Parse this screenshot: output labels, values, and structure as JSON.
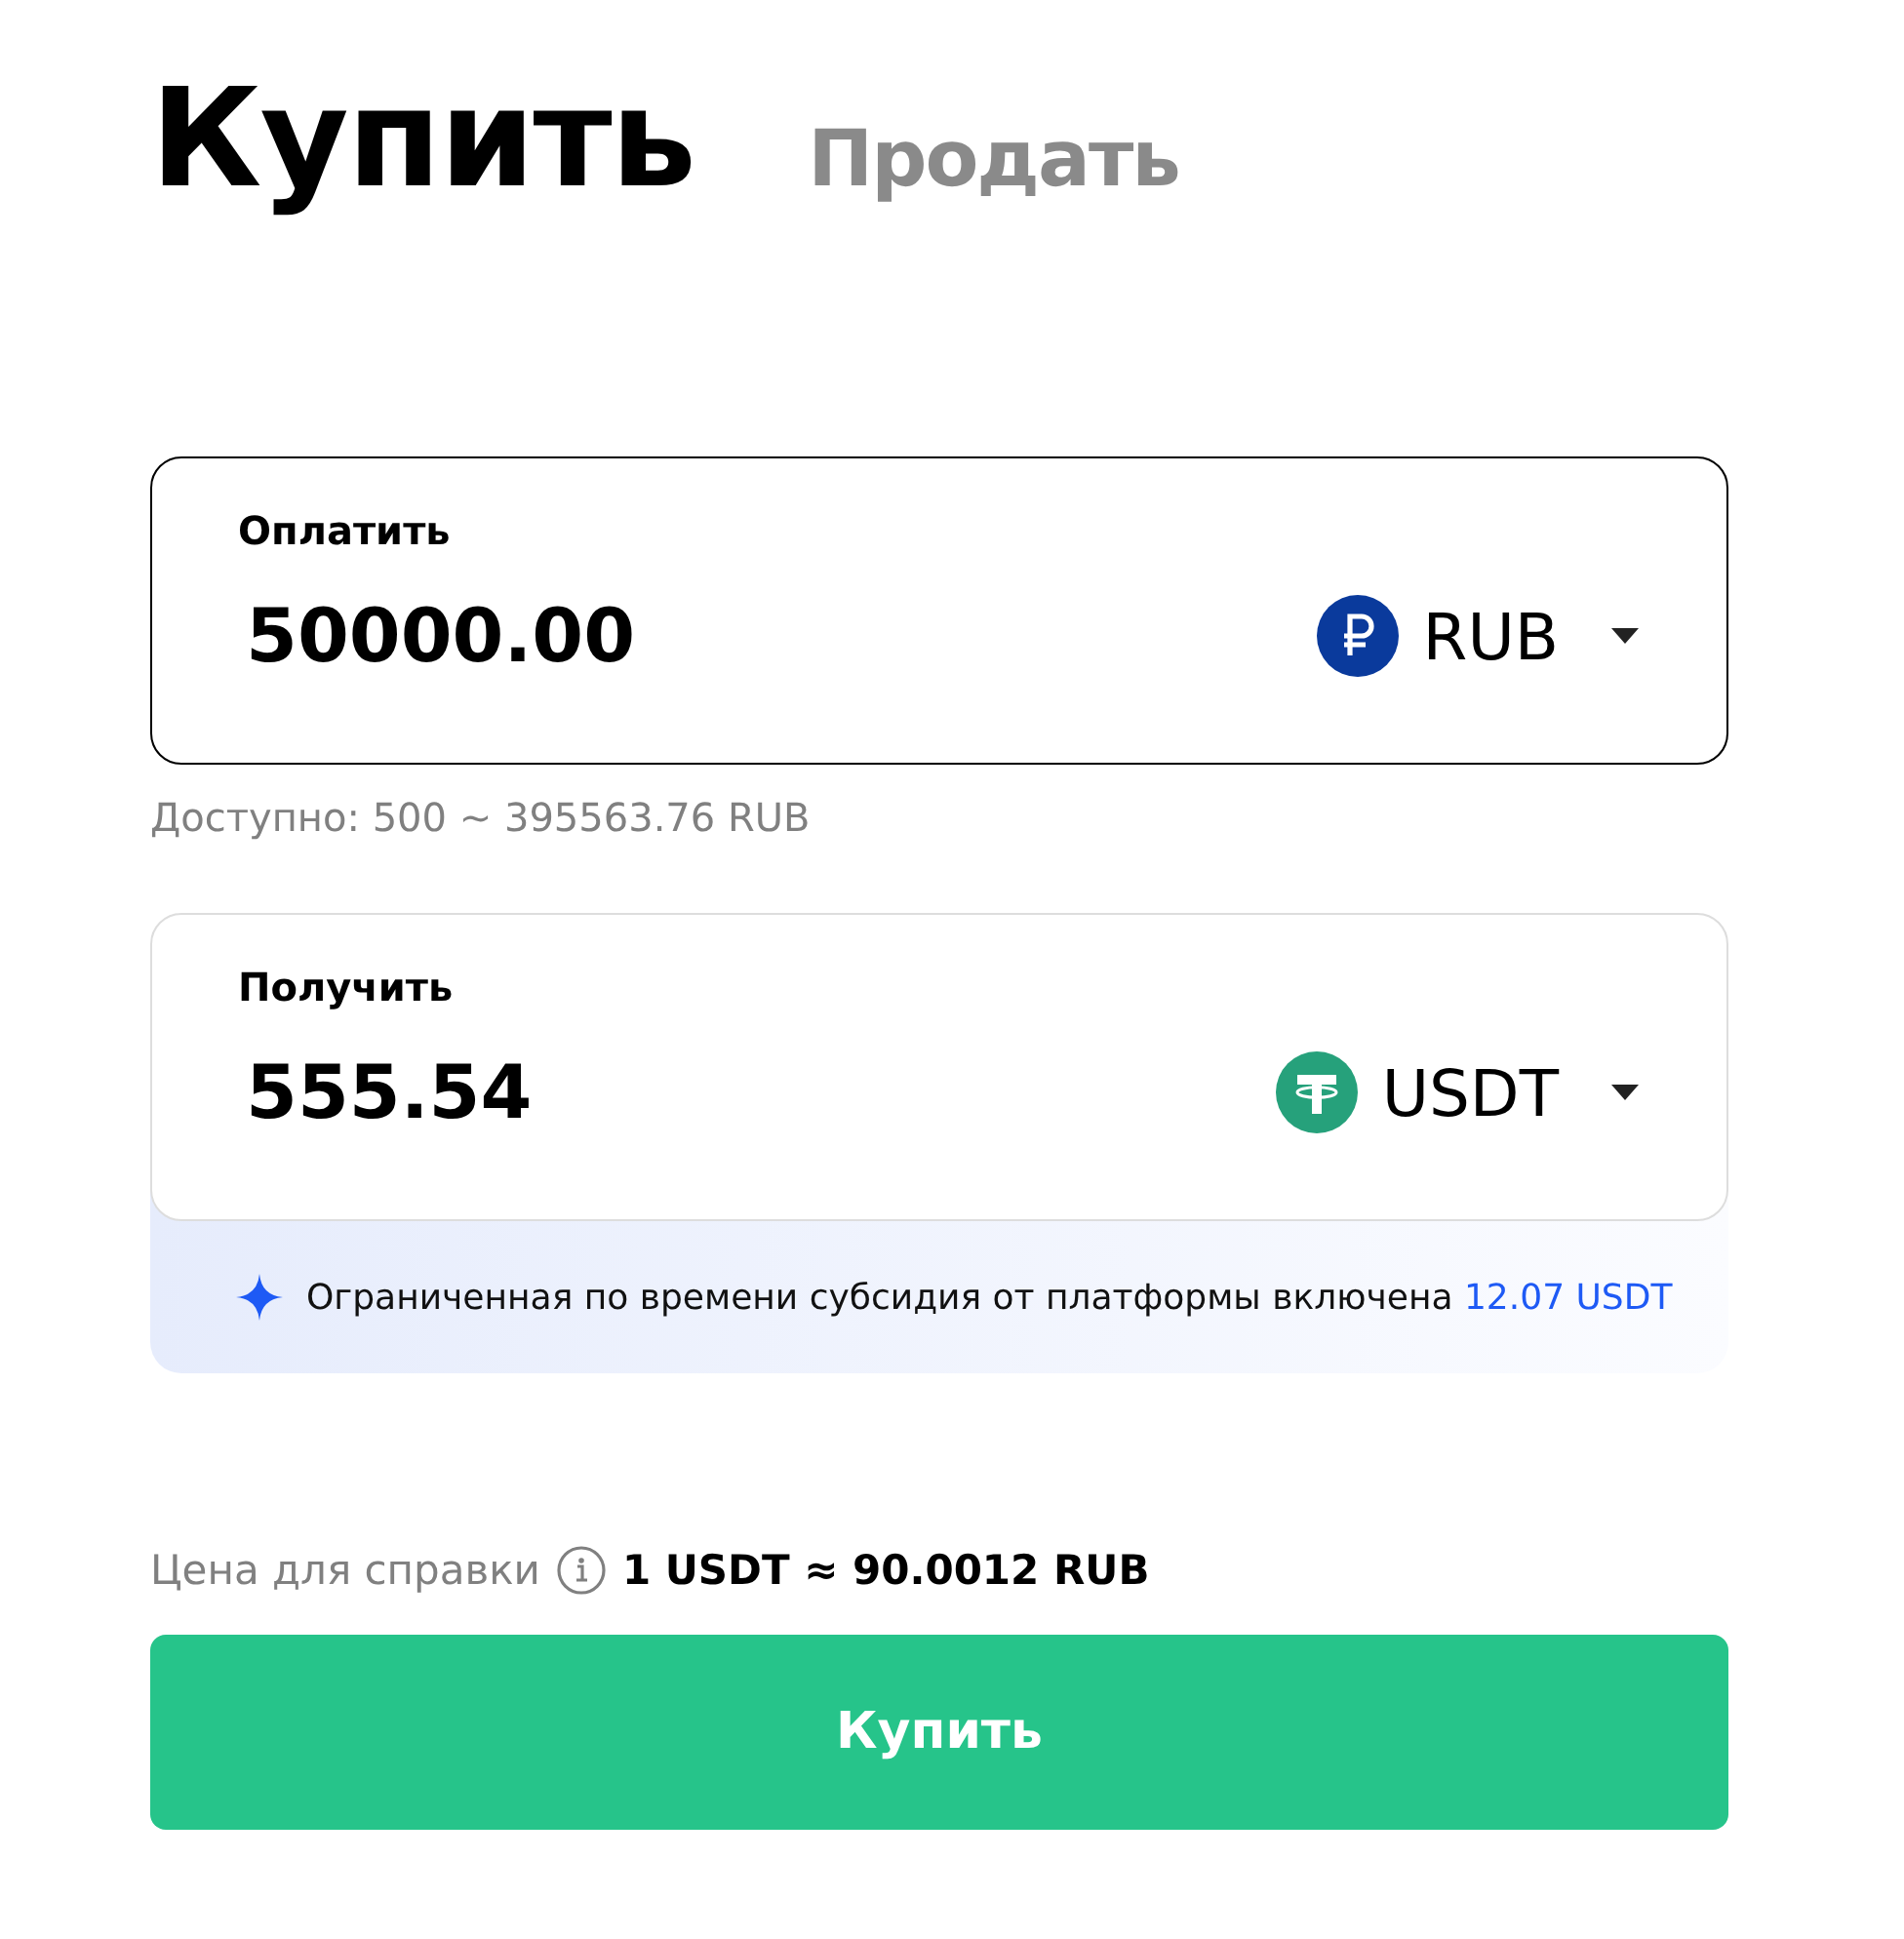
{
  "tabs": [
    {
      "label": "Купить",
      "selected": true
    },
    {
      "label": "Продать",
      "selected": false
    }
  ],
  "pay": {
    "label": "Оплатить",
    "value": "50000.00",
    "currency": "RUB",
    "kind": "rub",
    "focused": true
  },
  "available": "Доступно: 500 ~ 395563.76 RUB",
  "receive": {
    "label": "Получить",
    "value": "555.54",
    "currency": "USDT",
    "kind": "usdt",
    "focused": false
  },
  "subsidy": {
    "text": "Ограниченная по времени субсидия от платформы включена ",
    "highlight": "12.07 USDT"
  },
  "price": {
    "label": "Цена для справки",
    "value": "1 USDT ≈ 90.0012 RUB"
  },
  "button": "Купить"
}
